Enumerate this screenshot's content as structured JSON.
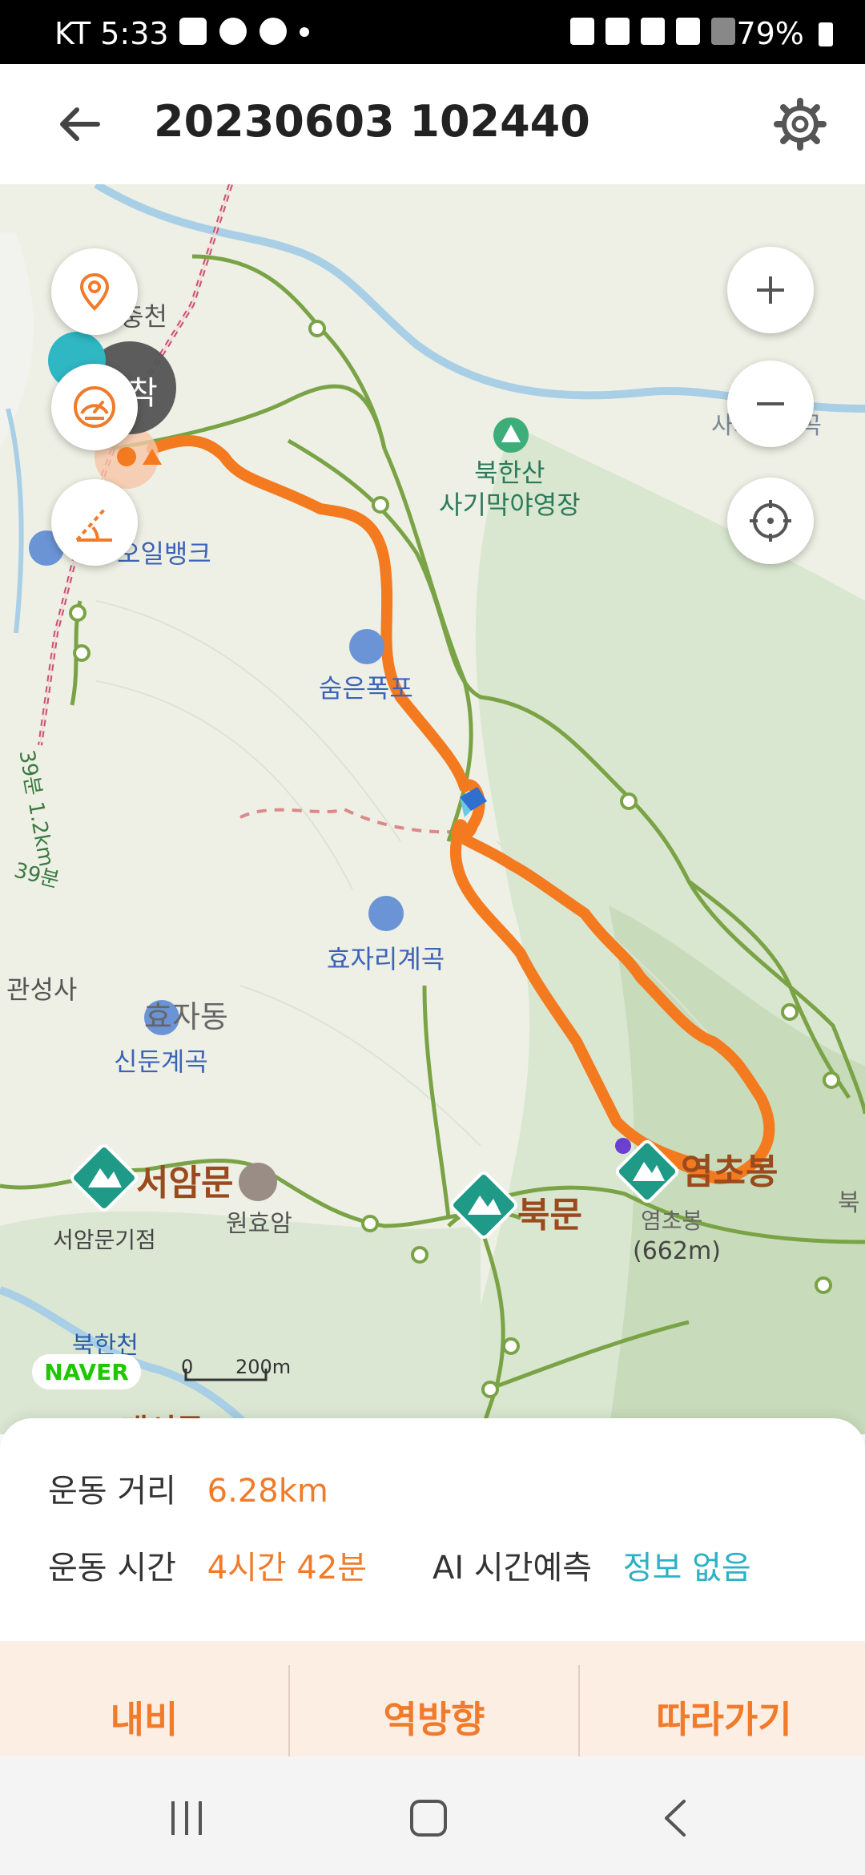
{
  "status_bar": {
    "carrier_time": "KT 5:33",
    "battery": "79%",
    "left_icons": [
      "gallery-icon",
      "walk-icon",
      "talk-icon",
      "dot"
    ],
    "right_icons": [
      "mute-icon",
      "location-icon",
      "hd-icon",
      "5g-icon",
      "signal-icon",
      "battery-icon"
    ]
  },
  "header": {
    "title": "20230603 102440"
  },
  "map": {
    "labels": {
      "stream": "충천",
      "arrive": "착",
      "gas": "오일뱅크",
      "campsite_line1": "북한산",
      "campsite_line2": "사기막야영장",
      "waterfall": "숨은폭포",
      "valley": "효자리계곡",
      "village": "효자동",
      "valley2": "신둔계곡",
      "temple_left": "관성사",
      "bus_time1": "39분",
      "bus_dist": "39분 1.2km",
      "seoam": "서암문",
      "seoam_site": "서암문기점",
      "temple": "원효암",
      "bukmun": "북문",
      "peak": "염초봉",
      "peak_sub": "염초봉",
      "peak_elev": "(662m)",
      "bukhancheon": "북한천",
      "right_edge": "북",
      "right_top": "사기막계곡",
      "bottom_cut": "대서문"
    },
    "scale": {
      "zero": "0",
      "length": "200m"
    },
    "brand": "NAVER",
    "route_color": "#f47a20",
    "trail_color": "#7aa346"
  },
  "stats": {
    "distance_label": "운동 거리",
    "distance_value": "6.28km",
    "time_label": "운동 시간",
    "time_value": "4시간 42분",
    "ai_label": "AI 시간예측",
    "ai_value": "정보 없음"
  },
  "actions": {
    "navi": "내비",
    "reverse": "역방향",
    "follow": "따라가기"
  },
  "colors": {
    "accent": "#f07b2a",
    "cyan": "#2cb1c5",
    "action_bg": "#fdeee3"
  }
}
